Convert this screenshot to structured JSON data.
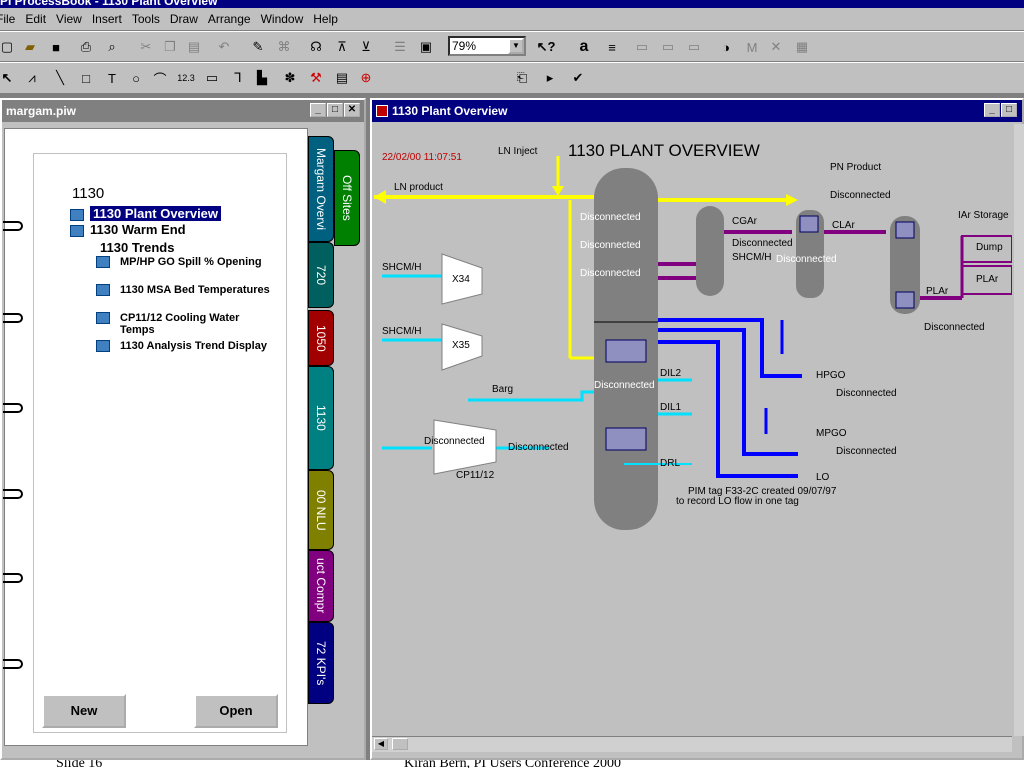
{
  "app": {
    "title": "PI ProcessBook - 1130 Plant Overview"
  },
  "menu": [
    "File",
    "Edit",
    "View",
    "Insert",
    "Tools",
    "Draw",
    "Arrange",
    "Window",
    "Help"
  ],
  "toolbar": {
    "zoom": "79%"
  },
  "left_window": {
    "title": "margam.piw",
    "tree_root": "1130",
    "items": [
      "1130 Plant Overview",
      "1130 Warm End",
      "1130 Trends"
    ],
    "trends": [
      "MP/HP GO Spill % Opening",
      "1130 MSA Bed Temperatures",
      "CP11/12 Cooling Water Temps",
      "1130 Analysis Trend Display"
    ],
    "tabs": [
      "Margam Overvi",
      "Off Sites",
      "720",
      "1050",
      "1130",
      "00 NLU",
      "uct Compr",
      "72 KPI's"
    ],
    "new_label": "New",
    "open_label": "Open"
  },
  "right_window": {
    "title": "1130 Plant Overview",
    "timestamp": "22/02/00 11:07:51",
    "heading": "1130 PLANT OVERVIEW",
    "labels": {
      "ln_inject": "LN Inject",
      "ln_product": "LN product",
      "pn_product": "PN Product",
      "cgar": "CGAr",
      "clar": "CLAr",
      "plar": "PLAr",
      "iar_storage": "IAr Storage",
      "dump": "Dump",
      "plar_box": "PLAr",
      "shcm1": "SHCM/H",
      "shcm2": "SHCM/H",
      "shcm3": "SHCM/H",
      "x34": "X34",
      "x35": "X35",
      "barg": "Barg",
      "cp1112": "CP11/12",
      "dil2": "DIL2",
      "dil1": "DIL1",
      "drl": "DRL",
      "hpgo": "HPGO",
      "mpgo": "MPGO",
      "lo": "LO",
      "disconnected": "Disconnected",
      "pim_note_1": "PIM tag F33-2C created 09/07/97",
      "pim_note_2": "to record LO flow in one tag"
    }
  },
  "footer": {
    "left": "Slide 16",
    "center": "Kiran Bern, PI Users Conference 2000"
  }
}
